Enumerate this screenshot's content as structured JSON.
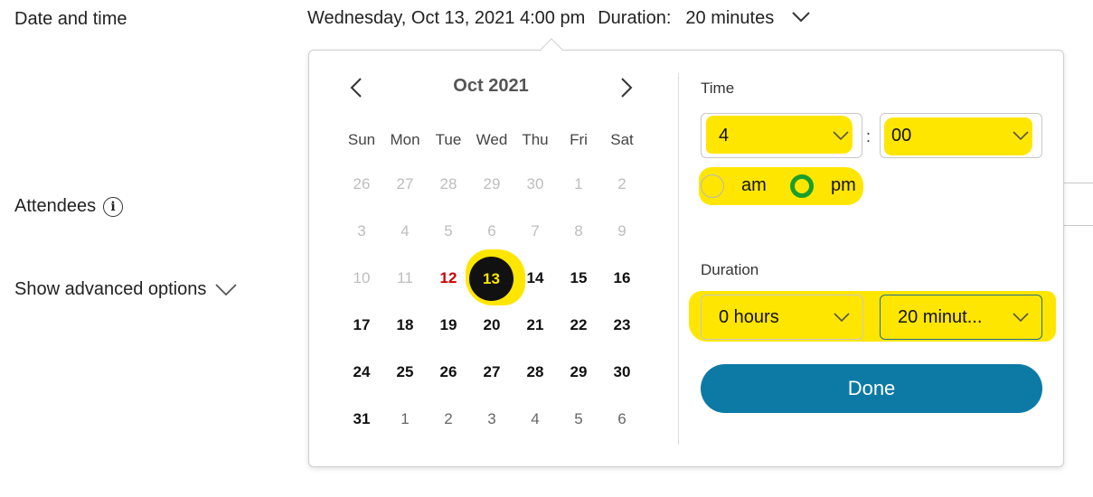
{
  "form": {
    "date_time_label": "Date and time",
    "attendees_label": "Attendees",
    "advanced_label": "Show advanced options",
    "info_icon": "info-icon",
    "chevron_icon": "chevron-down-icon"
  },
  "summary": {
    "date_text": "Wednesday, Oct 13, 2021 4:00 pm",
    "duration_label": "Duration:",
    "duration_value": "20 minutes"
  },
  "calendar": {
    "month_title": "Oct 2021",
    "prev_icon": "chevron-left-icon",
    "next_icon": "chevron-right-icon",
    "weekdays": [
      "Sun",
      "Mon",
      "Tue",
      "Wed",
      "Thu",
      "Fri",
      "Sat"
    ],
    "weeks": [
      [
        "26",
        "27",
        "28",
        "29",
        "30",
        "1",
        "2"
      ],
      [
        "3",
        "4",
        "5",
        "6",
        "7",
        "8",
        "9"
      ],
      [
        "10",
        "11",
        "12",
        "13",
        "14",
        "15",
        "16"
      ],
      [
        "17",
        "18",
        "19",
        "20",
        "21",
        "22",
        "23"
      ],
      [
        "24",
        "25",
        "26",
        "27",
        "28",
        "29",
        "30"
      ],
      [
        "31",
        "1",
        "2",
        "3",
        "4",
        "5",
        "6"
      ]
    ],
    "selected_day": "13",
    "today_day": "12"
  },
  "time": {
    "label": "Time",
    "hour": "4",
    "colon": ":",
    "minute": "00",
    "am_label": "am",
    "pm_label": "pm",
    "selected_period": "pm"
  },
  "duration": {
    "label": "Duration",
    "hours": "0 hours",
    "minutes": "20 minut..."
  },
  "done_label": "Done",
  "colors": {
    "highlight": "#ffe600",
    "accent": "#0c7aa5",
    "radio_selected": "#1a9e2c",
    "today": "#cc0000"
  }
}
